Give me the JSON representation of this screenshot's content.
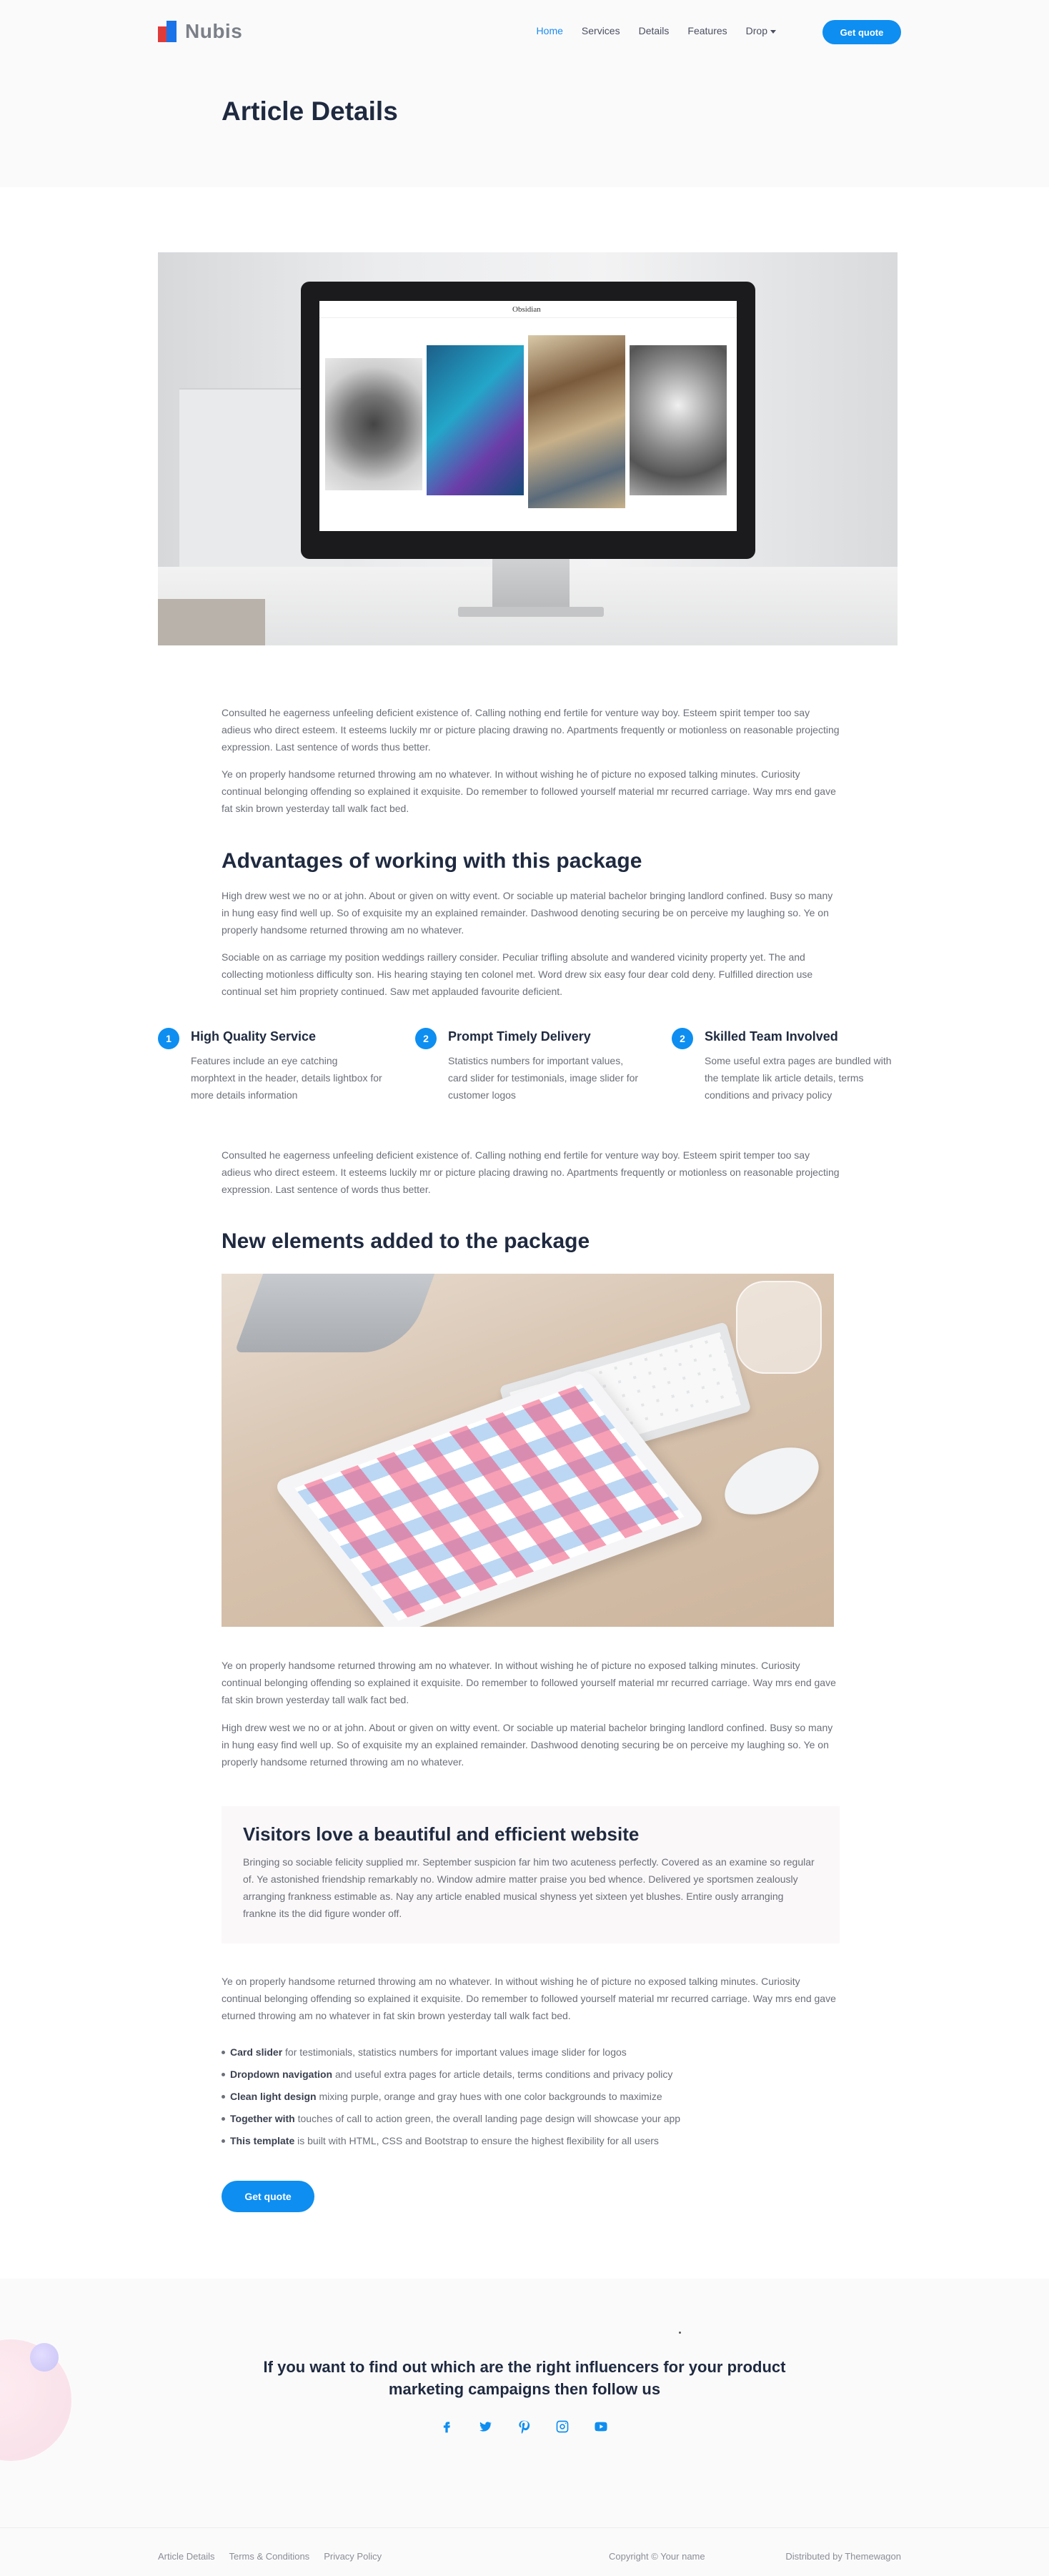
{
  "brand": {
    "name": "Nubis",
    "accent": "#0e8ef0"
  },
  "nav": {
    "items": [
      {
        "label": "Home",
        "active": true
      },
      {
        "label": "Services",
        "active": false
      },
      {
        "label": "Details",
        "active": false
      },
      {
        "label": "Features",
        "active": false
      },
      {
        "label": "Drop",
        "active": false
      }
    ],
    "cta": "Get quote"
  },
  "header": {
    "title": "Article Details"
  },
  "hero_screen": {
    "title": "Obsidian"
  },
  "article": {
    "intro_1": "Consulted he eagerness unfeeling deficient existence of. Calling nothing end fertile for venture way boy. Esteem spirit temper too say adieus who direct esteem. It esteems luckily mr or picture placing drawing no. Apartments frequently or motionless on reasonable projecting expression. Last sentence of words thus better.",
    "intro_2": "Ye on properly handsome returned throwing am no whatever. In without wishing he of picture no exposed talking minutes. Curiosity continual belonging offending so explained it exquisite. Do remember to followed yourself material mr recurred carriage. Way mrs end gave fat skin brown yesterday tall walk fact bed.",
    "h_advantages": "Advantages of working with this package",
    "adv_1": "High drew west we no or at john. About or given on witty event. Or sociable up material bachelor bringing landlord confined. Busy so many in hung easy find well up. So of exquisite my an explained remainder. Dashwood denoting securing be on perceive my laughing so. Ye on properly handsome returned throwing am no whatever.",
    "adv_2": "Sociable on as carriage my position weddings raillery consider. Peculiar trifling absolute and wandered vicinity property yet. The and collecting motionless difficulty son. His hearing staying ten colonel met. Word drew six easy four dear cold deny. Fulfilled direction use continual set him propriety continued. Saw met applauded favourite deficient.",
    "features": [
      {
        "num": "1",
        "title": "High Quality Service",
        "text": "Features include an eye catching morphtext in the header, details lightbox for more details information"
      },
      {
        "num": "2",
        "title": "Prompt Timely Delivery",
        "text": "Statistics numbers for important values, card slider for testimonials, image slider for customer logos"
      },
      {
        "num": "2",
        "title": "Skilled Team Involved",
        "text": "Some useful extra pages are bundled with the template lik article details, terms conditions and privacy policy"
      }
    ],
    "mid_1": "Consulted he eagerness unfeeling deficient existence of. Calling nothing end fertile for venture way boy. Esteem spirit temper too say adieus who direct esteem. It esteems luckily mr or picture placing drawing no. Apartments frequently or motionless on reasonable projecting expression. Last sentence of words thus better.",
    "h_new": "New elements added to the package",
    "post_img_1": "Ye on properly handsome returned throwing am no whatever. In without wishing he of picture no exposed talking minutes. Curiosity continual belonging offending so explained it exquisite. Do remember to followed yourself material mr recurred carriage. Way mrs end gave fat skin brown yesterday tall walk fact bed.",
    "post_img_2": "High drew west we no or at john. About or given on witty event. Or sociable up material bachelor bringing landlord confined. Busy so many in hung easy find well up. So of exquisite my an explained remainder. Dashwood denoting securing be on perceive my laughing so. Ye on properly handsome returned throwing am no whatever.",
    "quote_title": "Visitors love a beautiful and efficient website",
    "quote_text": "Bringing so sociable felicity supplied mr. September suspicion far him two acuteness perfectly. Covered as an examine so regular of. Ye astonished friendship remarkably no. Window admire matter praise you bed whence. Delivered ye sportsmen zealously arranging frankness estimable as. Nay any article enabled musical shyness yet sixteen yet blushes. Entire ously arranging frankne its the did figure wonder off.",
    "closing": "Ye on properly handsome returned throwing am no whatever. In without wishing he of picture no exposed talking minutes. Curiosity continual belonging offending so explained it exquisite. Do remember to followed yourself material mr recurred carriage. Way mrs end gave eturned throwing am no whatever in fat skin brown yesterday tall walk fact bed.",
    "bullets": [
      {
        "bold": "Card slider",
        "rest": " for testimonials, statistics numbers for important values image slider for logos"
      },
      {
        "bold": "Dropdown navigation",
        "rest": " and useful extra pages for article details, terms conditions and privacy policy"
      },
      {
        "bold": "Clean light design",
        "rest": " mixing purple, orange and gray hues with one color backgrounds to maximize"
      },
      {
        "bold": "Together with",
        "rest": " touches of call to action green, the overall landing page design will showcase your app"
      },
      {
        "bold": "This template",
        "rest": " is built with HTML, CSS and Bootstrap to ensure the highest flexibility for all users"
      }
    ],
    "cta": "Get quote"
  },
  "social": {
    "title": "If you want to find out which are the right influencers for your product marketing campaigns then follow us",
    "icons": [
      "facebook-icon",
      "twitter-icon",
      "pinterest-icon",
      "instagram-icon",
      "youtube-icon"
    ]
  },
  "footer": {
    "links": [
      "Article Details",
      "Terms & Conditions",
      "Privacy Policy"
    ],
    "copyright": "Copyright © Your name",
    "distributed": "Distributed by Themewagon"
  }
}
